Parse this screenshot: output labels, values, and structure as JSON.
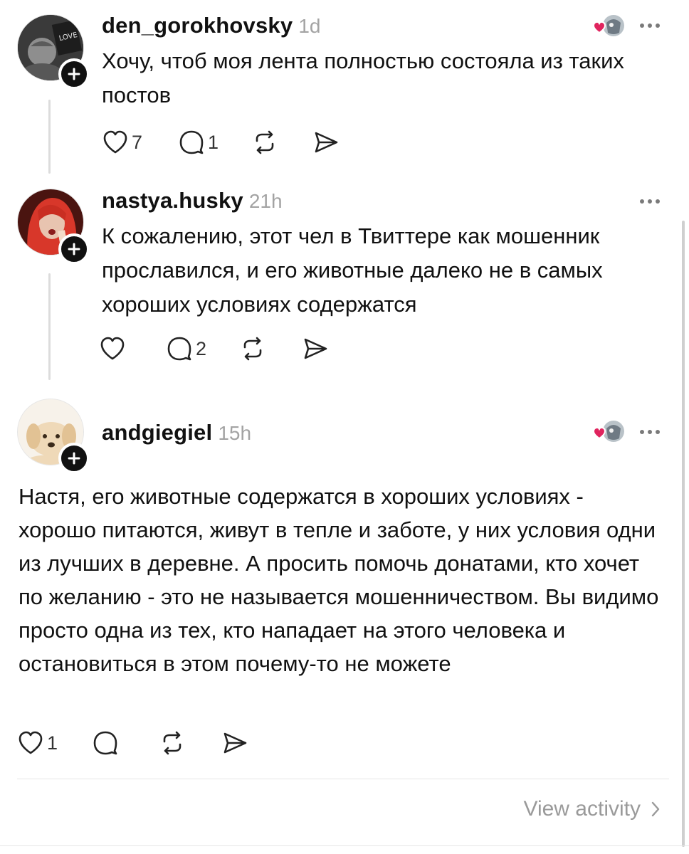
{
  "posts": [
    {
      "username": "den_gorokhovsky",
      "time": "1d",
      "text": "Хочу, чтоб моя лента полностью состояла из таких постов",
      "likes": "7",
      "replies": "1",
      "avatar_icon": "avatar-photo",
      "liked_by_icon": "liked-by-avatar-icon"
    },
    {
      "username": "nastya.husky",
      "time": "21h",
      "text": "К сожалению, этот чел в Твиттере как мошенник прославился, и его животные далеко не в самых хороших условиях содержатся",
      "likes": "",
      "replies": "2",
      "avatar_icon": "avatar-photo"
    },
    {
      "username": "andgiegiel",
      "time": "15h",
      "text": "Настя, его животные содержатся в хороших условиях - хорошо питаются, живут в тепле и заботе, у них условия одни из лучших в деревне. А просить помочь донатами, кто хочет по желанию - это не называется мошенничеством. Вы видимо просто одна из тех, кто нападает на этого человека и остановиться в этом почему-то не можете",
      "likes": "1",
      "replies": "",
      "avatar_icon": "puppy-avatar",
      "liked_by_icon": "liked-by-avatar-icon"
    }
  ],
  "footer": {
    "view_activity": "View activity"
  },
  "colors": {
    "text": "#111111",
    "muted": "#a3a3a3",
    "heart": "#e0245e",
    "divider": "#e6e6e6"
  }
}
